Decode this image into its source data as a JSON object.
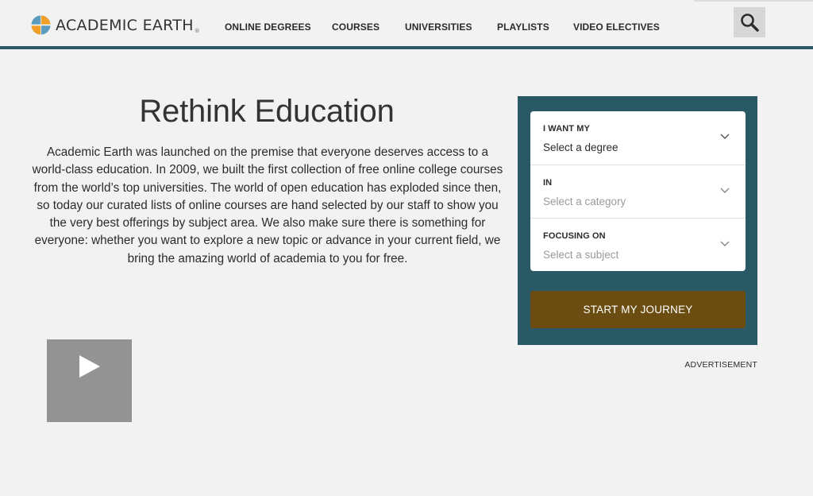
{
  "brand": {
    "name": "ACADEMIC EARTH",
    "registered": "®",
    "colors": {
      "header_accent": "#2a5966",
      "cta": "#6b4d12",
      "logo_orange": "#f0a028",
      "logo_blue": "#5a9bbf"
    }
  },
  "nav": {
    "items": [
      "ONLINE DEGREES",
      "COURSES",
      "UNIVERSITIES",
      "PLAYLISTS",
      "VIDEO ELECTIVES"
    ],
    "search_icon": "search-icon"
  },
  "hero": {
    "title": "Rethink Education",
    "body": "Academic Earth was launched on the premise that everyone deserves access to a world-class education. In 2009, we built the first collection of free online college courses from the world’s top universities. The world of open education has exploded since then, so today our curated lists of online courses are hand selected by our staff to show you the very best offerings by subject area. We also make sure there is something for everyone: whether you want to explore a new topic or advance in your current field, we bring the amazing world of academia to you for free."
  },
  "video": {
    "icon": "play-icon"
  },
  "form": {
    "fields": [
      {
        "label": "I WANT MY",
        "value": "Select a degree"
      },
      {
        "label": "IN",
        "value": "Select a category"
      },
      {
        "label": "FOCUSING ON",
        "value": "Select a subject"
      }
    ],
    "cta": "START MY JOURNEY"
  },
  "ad": {
    "label": "ADVERTISEMENT"
  }
}
